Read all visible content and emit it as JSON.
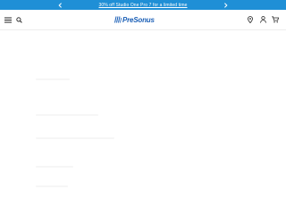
{
  "promo": {
    "text": "30% off Studio One Pro 7 for a limited time",
    "color": "#1f8fd6"
  },
  "header": {
    "logo_text": "PreSonus",
    "brand_color": "#1b5fb6",
    "icons": [
      "menu-icon",
      "search-icon",
      "location-icon",
      "account-icon",
      "cart-icon"
    ]
  }
}
